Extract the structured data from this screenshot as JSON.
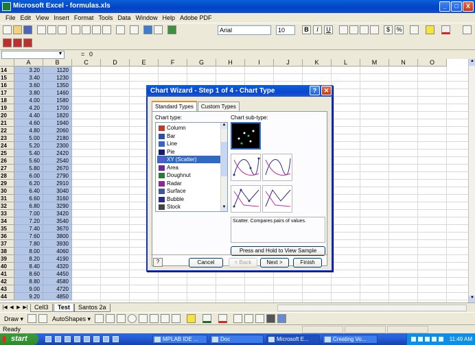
{
  "window": {
    "title": "Microsoft Excel - formulas.xls",
    "buttons": [
      "_",
      "□",
      "X"
    ]
  },
  "menu": [
    "File",
    "Edit",
    "View",
    "Insert",
    "Format",
    "Tools",
    "Data",
    "Window",
    "Help",
    "Adobe PDF"
  ],
  "toolbar": {
    "font_name": "Arial",
    "font_size": "10",
    "bold": "B",
    "italic": "I",
    "underline": "U",
    "percent": "%",
    "currency": "$"
  },
  "formula_bar": {
    "fx": "=",
    "value": "0"
  },
  "grid": {
    "columns": [
      "A",
      "B",
      "C",
      "D",
      "E",
      "F",
      "G",
      "H",
      "I",
      "J",
      "K",
      "L",
      "M",
      "N",
      "O"
    ],
    "rows": [
      {
        "n": "14",
        "a": "3.20",
        "b": "1120"
      },
      {
        "n": "15",
        "a": "3.40",
        "b": "1230"
      },
      {
        "n": "16",
        "a": "3.60",
        "b": "1350"
      },
      {
        "n": "17",
        "a": "3.80",
        "b": "1460"
      },
      {
        "n": "18",
        "a": "4.00",
        "b": "1580"
      },
      {
        "n": "19",
        "a": "4.20",
        "b": "1700"
      },
      {
        "n": "20",
        "a": "4.40",
        "b": "1820"
      },
      {
        "n": "21",
        "a": "4.60",
        "b": "1940"
      },
      {
        "n": "22",
        "a": "4.80",
        "b": "2060"
      },
      {
        "n": "23",
        "a": "5.00",
        "b": "2180"
      },
      {
        "n": "24",
        "a": "5.20",
        "b": "2300"
      },
      {
        "n": "25",
        "a": "5.40",
        "b": "2420"
      },
      {
        "n": "26",
        "a": "5.60",
        "b": "2540"
      },
      {
        "n": "27",
        "a": "5.80",
        "b": "2670"
      },
      {
        "n": "28",
        "a": "6.00",
        "b": "2790"
      },
      {
        "n": "29",
        "a": "6.20",
        "b": "2910"
      },
      {
        "n": "30",
        "a": "6.40",
        "b": "3040"
      },
      {
        "n": "31",
        "a": "6.60",
        "b": "3160"
      },
      {
        "n": "32",
        "a": "6.80",
        "b": "3290"
      },
      {
        "n": "33",
        "a": "7.00",
        "b": "3420"
      },
      {
        "n": "34",
        "a": "7.20",
        "b": "3540"
      },
      {
        "n": "35",
        "a": "7.40",
        "b": "3670"
      },
      {
        "n": "36",
        "a": "7.60",
        "b": "3800"
      },
      {
        "n": "37",
        "a": "7.80",
        "b": "3930"
      },
      {
        "n": "38",
        "a": "8.00",
        "b": "4060"
      },
      {
        "n": "39",
        "a": "8.20",
        "b": "4190"
      },
      {
        "n": "40",
        "a": "8.40",
        "b": "4320"
      },
      {
        "n": "41",
        "a": "8.60",
        "b": "4450"
      },
      {
        "n": "42",
        "a": "8.80",
        "b": "4580"
      },
      {
        "n": "43",
        "a": "9.00",
        "b": "4720"
      },
      {
        "n": "44",
        "a": "9.20",
        "b": "4850"
      }
    ]
  },
  "sheet_tabs": [
    "Cell3",
    "Test",
    "Santos 2a"
  ],
  "active_sheet": "Test",
  "drawing": {
    "draw": "Draw ▾",
    "autoshapes": "AutoShapes ▾"
  },
  "status": "Ready",
  "dialog": {
    "title": "Chart Wizard - Step 1 of 4 - Chart Type",
    "tabs": [
      "Standard Types",
      "Custom Types"
    ],
    "chart_type_label": "Chart type:",
    "subtype_label": "Chart sub-type:",
    "chart_types": [
      {
        "label": "Column",
        "icon": "column-chart-icon",
        "color": "#c03b2b"
      },
      {
        "label": "Bar",
        "icon": "bar-chart-icon",
        "color": "#2d4fa8"
      },
      {
        "label": "Line",
        "icon": "line-chart-icon",
        "color": "#3a62c8"
      },
      {
        "label": "Pie",
        "icon": "pie-chart-icon",
        "color": "#1a1a6a"
      },
      {
        "label": "XY (Scatter)",
        "icon": "scatter-chart-icon",
        "color": "#5a5ad0"
      },
      {
        "label": "Area",
        "icon": "area-chart-icon",
        "color": "#6a2a9a"
      },
      {
        "label": "Doughnut",
        "icon": "doughnut-chart-icon",
        "color": "#2a7a3a"
      },
      {
        "label": "Radar",
        "icon": "radar-chart-icon",
        "color": "#8a2a8a"
      },
      {
        "label": "Surface",
        "icon": "surface-chart-icon",
        "color": "#3a5a9a"
      },
      {
        "label": "Bubble",
        "icon": "bubble-chart-icon",
        "color": "#2a2a8a"
      },
      {
        "label": "Stock",
        "icon": "stock-chart-icon",
        "color": "#444444"
      }
    ],
    "selected_type": "XY (Scatter)",
    "description": "Scatter. Compares pairs of values.",
    "sample_button": "Press and Hold to View Sample",
    "cancel": "Cancel",
    "back": "< Back",
    "next": "Next >",
    "finish": "Finish",
    "help": "?"
  },
  "taskbar": {
    "start": "start",
    "buttons": [
      {
        "label": "MPLAB IDE ..."
      },
      {
        "label": "Doc"
      },
      {
        "label": "Microsoft E..."
      },
      {
        "label": "Creating Vo..."
      }
    ],
    "clock": "11:49 AM"
  }
}
